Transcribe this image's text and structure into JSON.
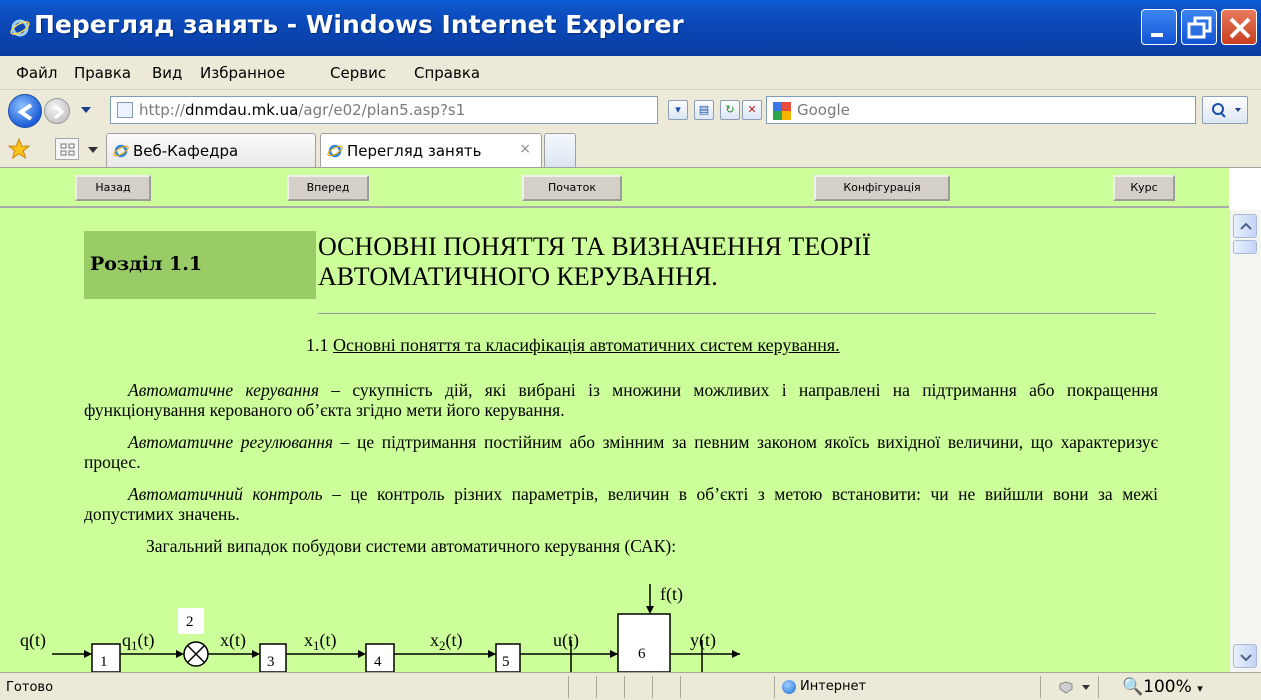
{
  "window": {
    "title": "Перегляд занять - Windows Internet Explorer"
  },
  "menu": [
    "Файл",
    "Правка",
    "Вид",
    "Избранное",
    "Сервис",
    "Справка"
  ],
  "address": {
    "url_prefix": "http://",
    "url_host": "dnmdau.mk.ua",
    "url_path": "/agr/e02/plan5.asp?s1"
  },
  "search": {
    "placeholder": "Google"
  },
  "tabs": [
    {
      "label": "Веб-Кафедра"
    },
    {
      "label": "Перегляд занять",
      "close": "×"
    }
  ],
  "page_nav": [
    "Назад",
    "Вперед",
    "Початок",
    "Конфігурація",
    "Курс"
  ],
  "content": {
    "section_label": "Розділ 1.1",
    "title_line1": "ОСНОВНІ ПОНЯТТЯ ТА ВИЗНАЧЕННЯ ТЕОРІЇ",
    "title_line2": "АВТОМАТИЧНОГО КЕРУВАННЯ.",
    "subtitle_num": "1.1",
    "subtitle_text": "Основні поняття та класифікація автоматичних систем керування.",
    "p1_term": "Автоматичне керування",
    "p1_text": " – сукупність дій, які вибрані із множини можливих і направлені на підтримання або покращення функціонування керованого об’єкта згідно мети його керування.",
    "p2_term": "Автоматичне регулювання",
    "p2_text": " – це підтримання постійним або змінним за певним законом якоїсь вихідної величини, що характеризує процес.",
    "p3_term": "Автоматичний контроль",
    "p3_text": " – це контроль різних параметрів, величин в об’єкті з метою встановити: чи не вийшли вони за межі допустимих значень.",
    "p4_text": "Загальний випадок побудови системи автоматичного керування (САК):"
  },
  "diagram": {
    "labels": {
      "q": "q(t)",
      "q1": "q",
      "q1_sub": "1",
      "q1_tail": "(t)",
      "x": "x(t)",
      "x1": "x",
      "x1_sub": "1",
      "x1_tail": "(t)",
      "x2": "x",
      "x2_sub": "2",
      "x2_tail": "(t)",
      "u": "u(t)",
      "f": "f(t)",
      "y": "y(t)"
    },
    "blocks": [
      "1",
      "2",
      "3",
      "4",
      "5",
      "6"
    ]
  },
  "status": {
    "text": "Готово",
    "zone": "Интернет",
    "zoom": "100%"
  }
}
